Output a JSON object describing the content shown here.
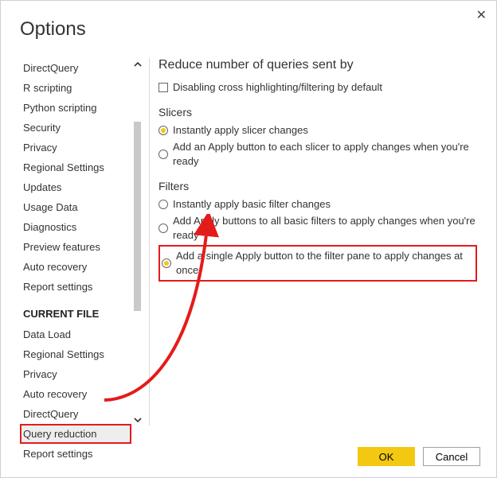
{
  "window": {
    "title": "Options",
    "close_glyph": "✕"
  },
  "sidebar": {
    "items": [
      {
        "label": "DirectQuery"
      },
      {
        "label": "R scripting"
      },
      {
        "label": "Python scripting"
      },
      {
        "label": "Security"
      },
      {
        "label": "Privacy"
      },
      {
        "label": "Regional Settings"
      },
      {
        "label": "Updates"
      },
      {
        "label": "Usage Data"
      },
      {
        "label": "Diagnostics"
      },
      {
        "label": "Preview features"
      },
      {
        "label": "Auto recovery"
      },
      {
        "label": "Report settings"
      }
    ],
    "section_title": "CURRENT FILE",
    "file_items": [
      {
        "label": "Data Load"
      },
      {
        "label": "Regional Settings"
      },
      {
        "label": "Privacy"
      },
      {
        "label": "Auto recovery"
      },
      {
        "label": "DirectQuery"
      },
      {
        "label": "Query reduction"
      },
      {
        "label": "Report settings"
      }
    ]
  },
  "content": {
    "heading1": "Reduce number of queries sent by",
    "chk1": "Disabling cross highlighting/filtering by default",
    "heading2": "Slicers",
    "slicer_opts": [
      "Instantly apply slicer changes",
      "Add an Apply button to each slicer to apply changes when you're ready"
    ],
    "heading3": "Filters",
    "filter_opts": [
      "Instantly apply basic filter changes",
      "Add Apply buttons to all basic filters to apply changes when you're ready",
      "Add a single Apply button to the filter pane to apply changes at once"
    ]
  },
  "footer": {
    "ok": "OK",
    "cancel": "Cancel"
  }
}
